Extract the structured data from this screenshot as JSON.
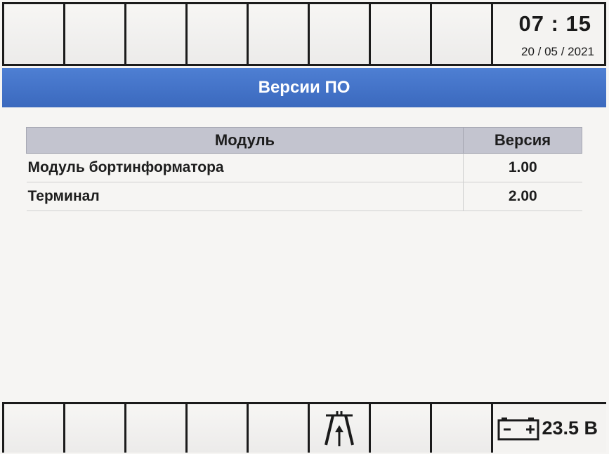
{
  "status": {
    "time": "07 : 15",
    "date": "20 / 05 / 2021",
    "voltage": "23.5 В"
  },
  "header": {
    "title": "Версии ПО"
  },
  "table": {
    "columns": [
      "Модуль",
      "Версия"
    ],
    "rows": [
      {
        "module": "Модуль бортинформатора",
        "version": "1.00"
      },
      {
        "module": "Терминал",
        "version": "2.00"
      }
    ]
  },
  "icons": {
    "road": "road-icon",
    "battery": "battery-icon"
  },
  "colors": {
    "title_bar": "#3f6fc6",
    "table_header": "#c3c4cf"
  }
}
